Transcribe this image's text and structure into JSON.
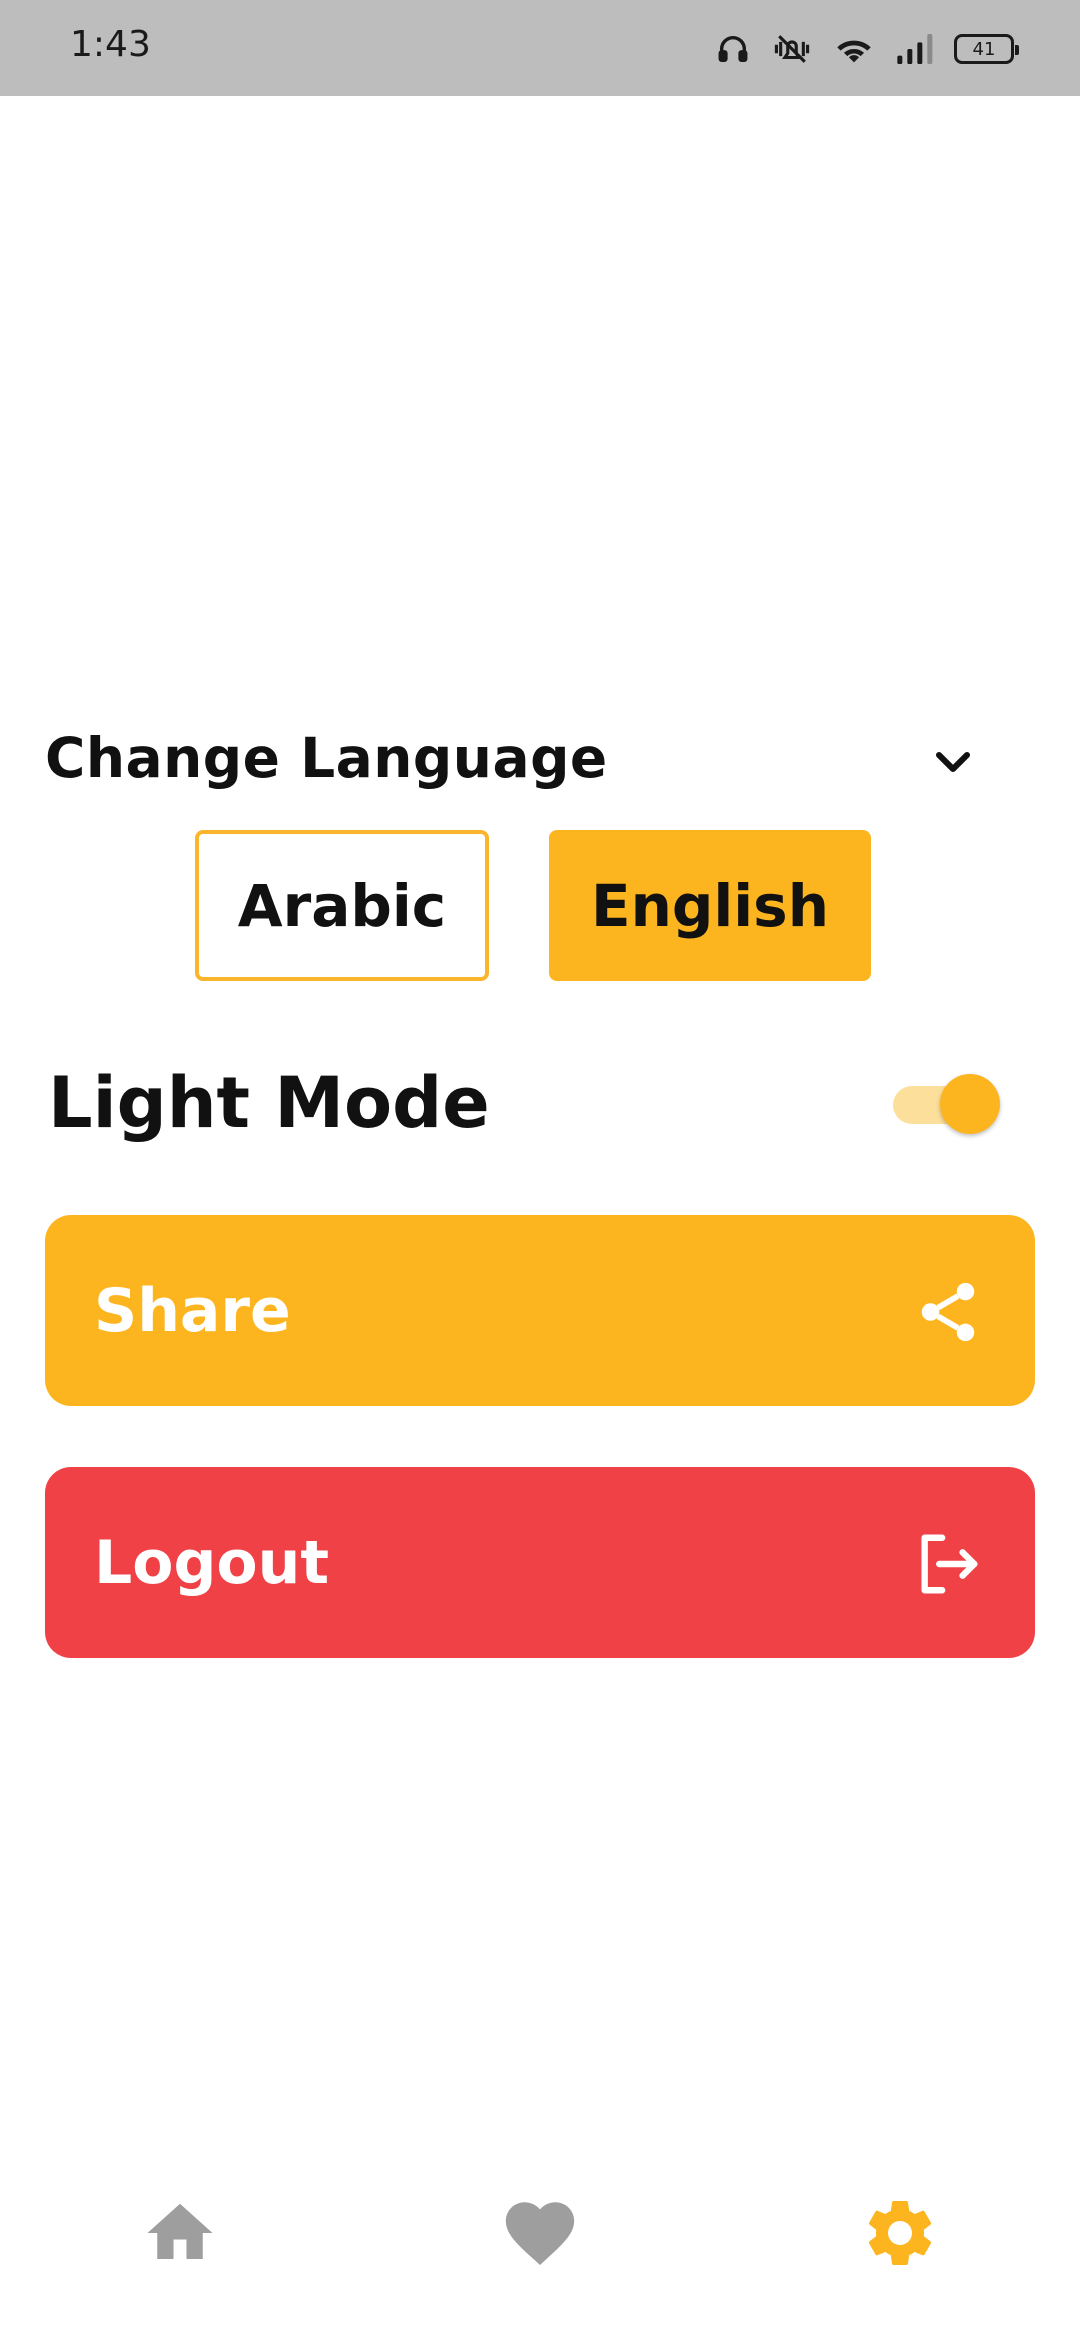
{
  "status_bar": {
    "time": "1:43",
    "battery": "41",
    "icons": [
      "headphones-icon",
      "vibrate-mute-icon",
      "wifi-icon",
      "signal-icon",
      "battery-icon"
    ]
  },
  "language": {
    "title": "Change Language",
    "options": [
      "Arabic",
      "English"
    ],
    "selected": "English"
  },
  "mode": {
    "label": "Light Mode",
    "enabled": true
  },
  "actions": {
    "share_label": "Share",
    "logout_label": "Logout"
  },
  "bottom_nav": {
    "items": [
      "home-icon",
      "heart-icon",
      "gear-icon"
    ],
    "active": "gear-icon"
  },
  "colors": {
    "accent": "#fdb51f",
    "danger": "#ef4146",
    "inactive": "#9e9e9e"
  }
}
